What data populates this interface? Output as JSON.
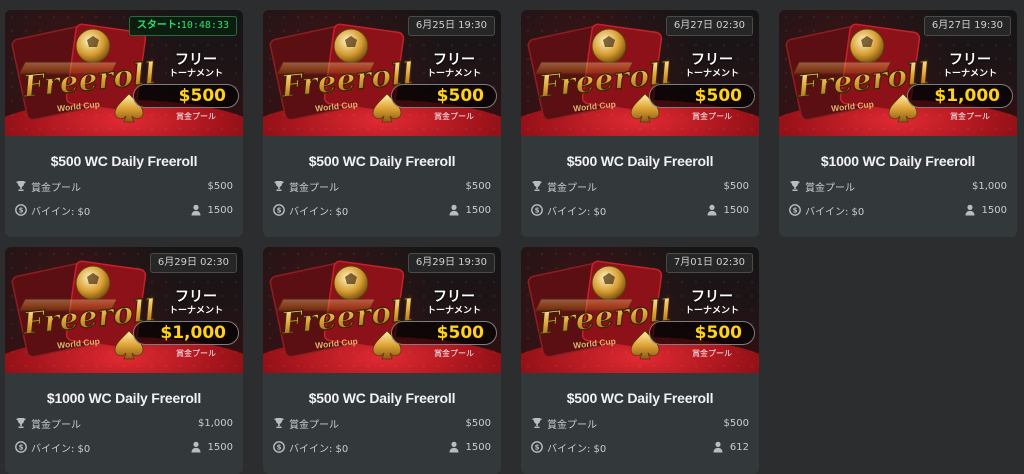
{
  "cards": [
    {
      "badge": {
        "type": "start",
        "label": "スタート:",
        "value": "10:48:33"
      },
      "promo": {
        "line1": "フリー",
        "line2": "トーナメント",
        "amount": "$500",
        "pool": "賞金プール"
      },
      "title": "$500 WC Daily Freeroll",
      "prize_label": "賞金プール",
      "prize_value": "$500",
      "buyin": "バイイン: $0",
      "players": "1500"
    },
    {
      "badge": {
        "type": "date",
        "label": "",
        "value": "6月25日 19:30"
      },
      "promo": {
        "line1": "フリー",
        "line2": "トーナメント",
        "amount": "$500",
        "pool": "賞金プール"
      },
      "title": "$500 WC Daily Freeroll",
      "prize_label": "賞金プール",
      "prize_value": "$500",
      "buyin": "バイイン: $0",
      "players": "1500"
    },
    {
      "badge": {
        "type": "date",
        "label": "",
        "value": "6月27日 02:30"
      },
      "promo": {
        "line1": "フリー",
        "line2": "トーナメント",
        "amount": "$500",
        "pool": "賞金プール"
      },
      "title": "$500 WC Daily Freeroll",
      "prize_label": "賞金プール",
      "prize_value": "$500",
      "buyin": "バイイン: $0",
      "players": "1500"
    },
    {
      "badge": {
        "type": "date",
        "label": "",
        "value": "6月27日 19:30"
      },
      "promo": {
        "line1": "フリー",
        "line2": "トーナメント",
        "amount": "$1,000",
        "pool": "賞金プール"
      },
      "title": "$1000 WC Daily Freeroll",
      "prize_label": "賞金プール",
      "prize_value": "$1,000",
      "buyin": "バイイン: $0",
      "players": "1500"
    },
    {
      "badge": {
        "type": "date",
        "label": "",
        "value": "6月29日 02:30"
      },
      "promo": {
        "line1": "フリー",
        "line2": "トーナメント",
        "amount": "$1,000",
        "pool": "賞金プール"
      },
      "title": "$1000 WC Daily Freeroll",
      "prize_label": "賞金プール",
      "prize_value": "$1,000",
      "buyin": "バイイン: $0",
      "players": "1500"
    },
    {
      "badge": {
        "type": "date",
        "label": "",
        "value": "6月29日 19:30"
      },
      "promo": {
        "line1": "フリー",
        "line2": "トーナメント",
        "amount": "$500",
        "pool": "賞金プール"
      },
      "title": "$500 WC Daily Freeroll",
      "prize_label": "賞金プール",
      "prize_value": "$500",
      "buyin": "バイイン: $0",
      "players": "1500"
    },
    {
      "badge": {
        "type": "date",
        "label": "",
        "value": "7月01日 02:30"
      },
      "promo": {
        "line1": "フリー",
        "line2": "トーナメント",
        "amount": "$500",
        "pool": "賞金プール"
      },
      "title": "$500 WC Daily Freeroll",
      "prize_label": "賞金プール",
      "prize_value": "$500",
      "buyin": "バイイン: $0",
      "players": "612"
    }
  ],
  "art": {
    "logo_text": "Freeroll",
    "logo_sub": "World Cup"
  },
  "icons": {
    "prize": "trophy-icon",
    "buyin": "coin-icon",
    "players": "person-icon"
  },
  "colors": {
    "background": "#2b2d2f",
    "card": "#33393b",
    "gold": "#ffcb21",
    "start_green": "#2fe06a",
    "felt_red": "#c81e28"
  }
}
